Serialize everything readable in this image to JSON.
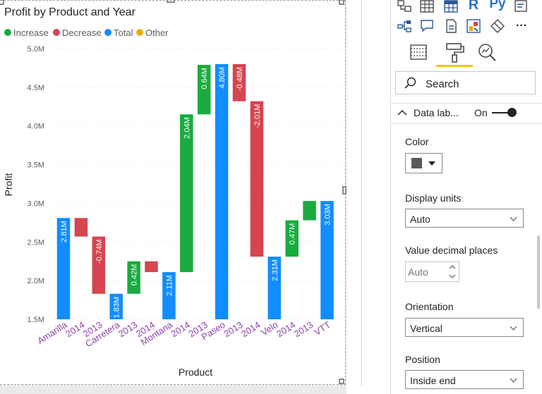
{
  "chart_data": {
    "type": "waterfall",
    "title": "Profit by Product and Year",
    "xlabel": "Product",
    "ylabel": "Profit",
    "ylim": [
      1500000,
      5000000
    ],
    "y_ticks": [
      "5.0M",
      "4.5M",
      "4.0M",
      "3.5M",
      "3.0M",
      "2.5M",
      "2.0M",
      "1.5M"
    ],
    "legend": [
      {
        "name": "Increase",
        "color": "#1aab40"
      },
      {
        "name": "Decrease",
        "color": "#d64550"
      },
      {
        "name": "Total",
        "color": "#118dff"
      },
      {
        "name": "Other",
        "color": "#e6b00b"
      }
    ],
    "steps": [
      {
        "label": "Amarilla",
        "kind": "total",
        "start": 1500000,
        "end": 2810000,
        "data_label": "2.81M"
      },
      {
        "label": "2014",
        "kind": "decrease",
        "start": 2810000,
        "end": 2570000,
        "data_label": ""
      },
      {
        "label": "2013",
        "kind": "decrease",
        "start": 2570000,
        "end": 1830000,
        "data_label": "-0.74M"
      },
      {
        "label": "Carretera",
        "kind": "total",
        "start": 1500000,
        "end": 1830000,
        "data_label": "1.83M"
      },
      {
        "label": "2013",
        "kind": "increase",
        "start": 1830000,
        "end": 2250000,
        "data_label": "0.42M"
      },
      {
        "label": "2014",
        "kind": "decrease",
        "start": 2250000,
        "end": 2110000,
        "data_label": ""
      },
      {
        "label": "Montana",
        "kind": "total",
        "start": 1500000,
        "end": 2110000,
        "data_label": "2.11M"
      },
      {
        "label": "2014",
        "kind": "increase",
        "start": 2110000,
        "end": 4150000,
        "data_label": "2.04M"
      },
      {
        "label": "2013",
        "kind": "increase",
        "start": 4150000,
        "end": 4790000,
        "data_label": "0.64M"
      },
      {
        "label": "Paseo",
        "kind": "total",
        "start": 1500000,
        "end": 4800000,
        "data_label": "4.80M"
      },
      {
        "label": "2013",
        "kind": "decrease",
        "start": 4800000,
        "end": 4320000,
        "data_label": "-0.48M"
      },
      {
        "label": "2014",
        "kind": "decrease",
        "start": 4320000,
        "end": 2310000,
        "data_label": "-2.01M"
      },
      {
        "label": "Velo",
        "kind": "total",
        "start": 1500000,
        "end": 2310000,
        "data_label": "2.31M"
      },
      {
        "label": "2014",
        "kind": "increase",
        "start": 2310000,
        "end": 2780000,
        "data_label": "0.47M"
      },
      {
        "label": "2013",
        "kind": "increase",
        "start": 2780000,
        "end": 3030000,
        "data_label": ""
      },
      {
        "label": "VTT",
        "kind": "total",
        "start": 1500000,
        "end": 3030000,
        "data_label": "3.03M"
      }
    ]
  },
  "pane": {
    "search_placeholder": "Search",
    "section_title": "Data lab...",
    "toggle_state": "On",
    "color_label": "Color",
    "display_units_label": "Display units",
    "display_units_value": "Auto",
    "decimal_label": "Value decimal places",
    "decimal_placeholder": "Auto",
    "orientation_label": "Orientation",
    "orientation_value": "Vertical",
    "position_label": "Position",
    "position_value": "Inside end",
    "icons": {
      "r_visual": "R",
      "py_visual": "Py",
      "more": "···"
    }
  }
}
